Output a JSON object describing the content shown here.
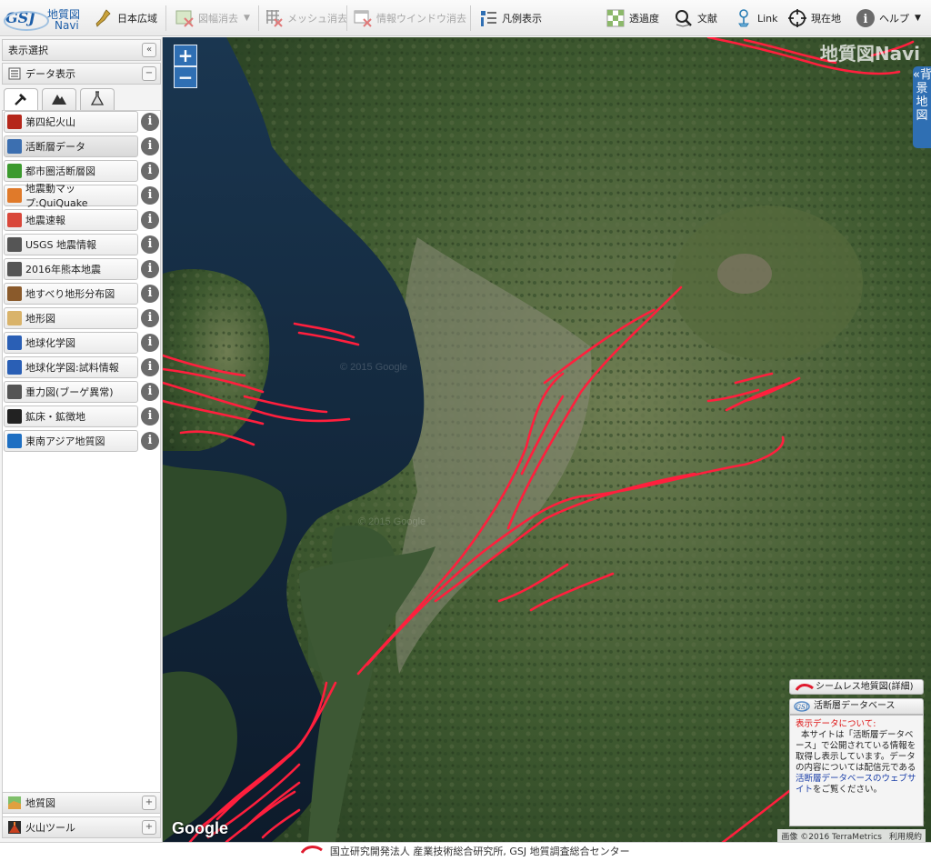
{
  "app": {
    "logo_line1": "地質図",
    "logo_line2": "Navi",
    "watermark": "地質図Navi"
  },
  "toolbar": {
    "japan_wide": "日本広域",
    "clear_sheet": "図幅消去",
    "clear_mesh": "メッシュ消去",
    "clear_info_window": "情報ウインドウ消去",
    "legend_display": "凡例表示",
    "transparency": "透過度",
    "literature": "文献",
    "link": "Link",
    "current_location": "現在地",
    "help": "ヘルプ"
  },
  "panel": {
    "title": "表示選択",
    "collapse_symbol": "«",
    "data_display": "データ表示",
    "data_display_toggle": "−",
    "tabs": [
      "hammer",
      "mountain",
      "flask"
    ],
    "items": [
      {
        "label": "第四紀火山",
        "icon": "volcano-icon",
        "color": "#b5271b"
      },
      {
        "label": "活断層データ",
        "icon": "fault-data-icon",
        "color": "#3c6fb0",
        "selected": true
      },
      {
        "label": "都市圏活断層図",
        "icon": "urban-fault-icon",
        "color": "#3c9a2e"
      },
      {
        "label": "地震動マップ:QuiQuake",
        "icon": "quiquake-icon",
        "color": "#e07a2a"
      },
      {
        "label": "地震速報",
        "icon": "earthquake-news-icon",
        "color": "#d9473a"
      },
      {
        "label": "USGS 地震情報",
        "icon": "usgs-icon",
        "color": "#555555"
      },
      {
        "label": "2016年熊本地震",
        "icon": "kumamoto-icon",
        "color": "#555555"
      },
      {
        "label": "地すべり地形分布図",
        "icon": "landslide-icon",
        "color": "#8a5a2b"
      },
      {
        "label": "地形図",
        "icon": "topo-map-icon",
        "color": "#d9b36a"
      },
      {
        "label": "地球化学図",
        "icon": "geochem-icon",
        "color": "#2a5fb5"
      },
      {
        "label": "地球化学図:試料情報",
        "icon": "geochem-sample-icon",
        "color": "#2a5fb5"
      },
      {
        "label": "重力図(ブーゲ異常)",
        "icon": "gravity-icon",
        "color": "#555555"
      },
      {
        "label": "鉱床・鉱徴地",
        "icon": "mine-icon",
        "color": "#222222"
      },
      {
        "label": "東南アジア地質図",
        "icon": "globe-icon",
        "color": "#1e6fc2"
      }
    ],
    "info_symbol": "i",
    "bottom_items": [
      {
        "label": "地質図",
        "icon": "geology-map-icon",
        "toggle": "+"
      },
      {
        "label": "火山ツール",
        "icon": "volcano-tool-icon",
        "toggle": "+"
      }
    ]
  },
  "map": {
    "zoom_in": "+",
    "zoom_out": "−",
    "background_tab": "«背景地図",
    "google": "Google",
    "imagery": "画像 ©2016 TerraMetrics",
    "terms": "利用規約"
  },
  "legend": {
    "seamless": "シームレス地質図(詳細)",
    "fault_db": "活断層データベース",
    "about_title": "表示データについて:",
    "text1": "本サイトは「活断層データベース」で公開されている情報を取得し表示しています。データの内容については配信元である",
    "link_text": "活断層データベースのウェブサイト",
    "text2": "をご覧ください。"
  },
  "footer": {
    "text": "国立研究開発法人 産業技術総合研究所, GSJ 地質調査総合センター"
  },
  "colors": {
    "accent": "#2f6fb3",
    "fault": "#ff1f3d"
  }
}
